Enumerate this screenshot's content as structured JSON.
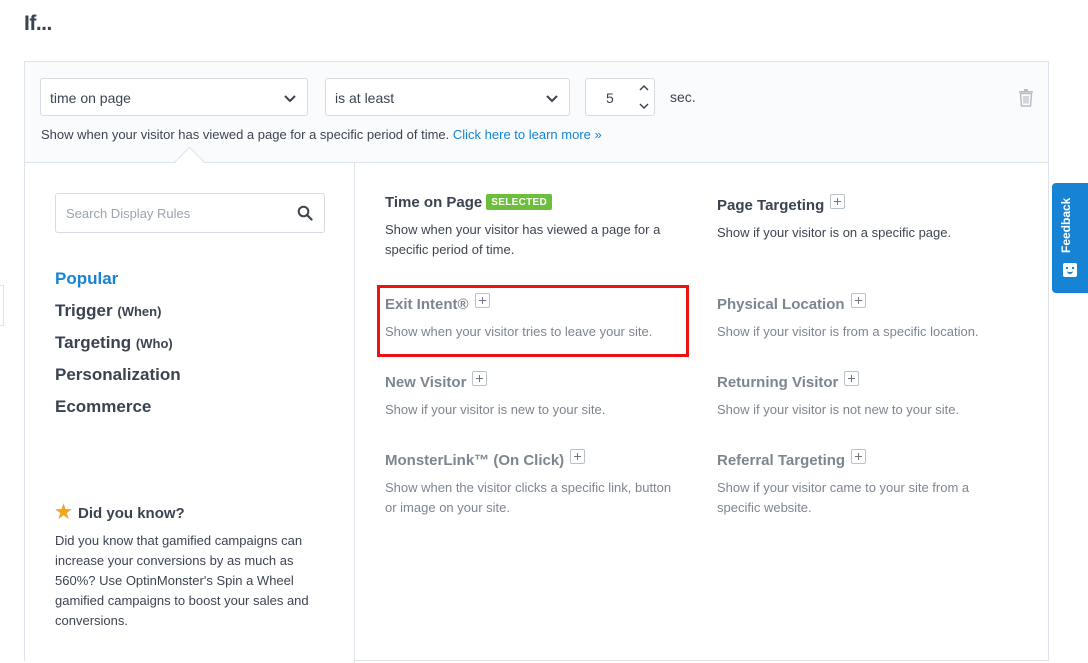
{
  "heading": "If...",
  "condition": {
    "field": "time on page",
    "operator": "is at least",
    "value": "5",
    "unit": "sec.",
    "description": "Show when your visitor has viewed a page for a specific period of time.",
    "learn_more": "Click here to learn more »"
  },
  "search": {
    "placeholder": "Search Display Rules"
  },
  "categories": [
    {
      "label": "Popular",
      "sub": ""
    },
    {
      "label": "Trigger",
      "sub": "(When)"
    },
    {
      "label": "Targeting",
      "sub": "(Who)"
    },
    {
      "label": "Personalization",
      "sub": ""
    },
    {
      "label": "Ecommerce",
      "sub": ""
    }
  ],
  "did_you_know": {
    "title": "Did you know?",
    "body": "Did you know that gamified campaigns can increase your conversions by as much as 560%? Use OptinMonster's Spin a Wheel gamified campaigns to boost your sales and conversions."
  },
  "rules": [
    {
      "title": "Time on Page",
      "badge": "SELECTED",
      "desc": "Show when your visitor has viewed a page for a specific period of time."
    },
    {
      "title": "Page Targeting",
      "desc": "Show if your visitor is on a specific page."
    },
    {
      "title": "Exit Intent®",
      "desc": "Show when your visitor tries to leave your site."
    },
    {
      "title": "Physical Location",
      "desc": "Show if your visitor is from a specific location."
    },
    {
      "title": "New Visitor",
      "desc": "Show if your visitor is new to your site."
    },
    {
      "title": "Returning Visitor",
      "desc": "Show if your visitor is not new to your site."
    },
    {
      "title": "MonsterLink™ (On Click)",
      "desc": "Show when the visitor clicks a specific link, button or image on your site."
    },
    {
      "title": "Referral Targeting",
      "desc": "Show if your visitor came to your site from a specific website."
    }
  ],
  "feedback": {
    "label": "Feedback"
  },
  "colors": {
    "accent": "#1683d4",
    "badge": "#6bbf3b",
    "highlight": "#ee1111"
  }
}
